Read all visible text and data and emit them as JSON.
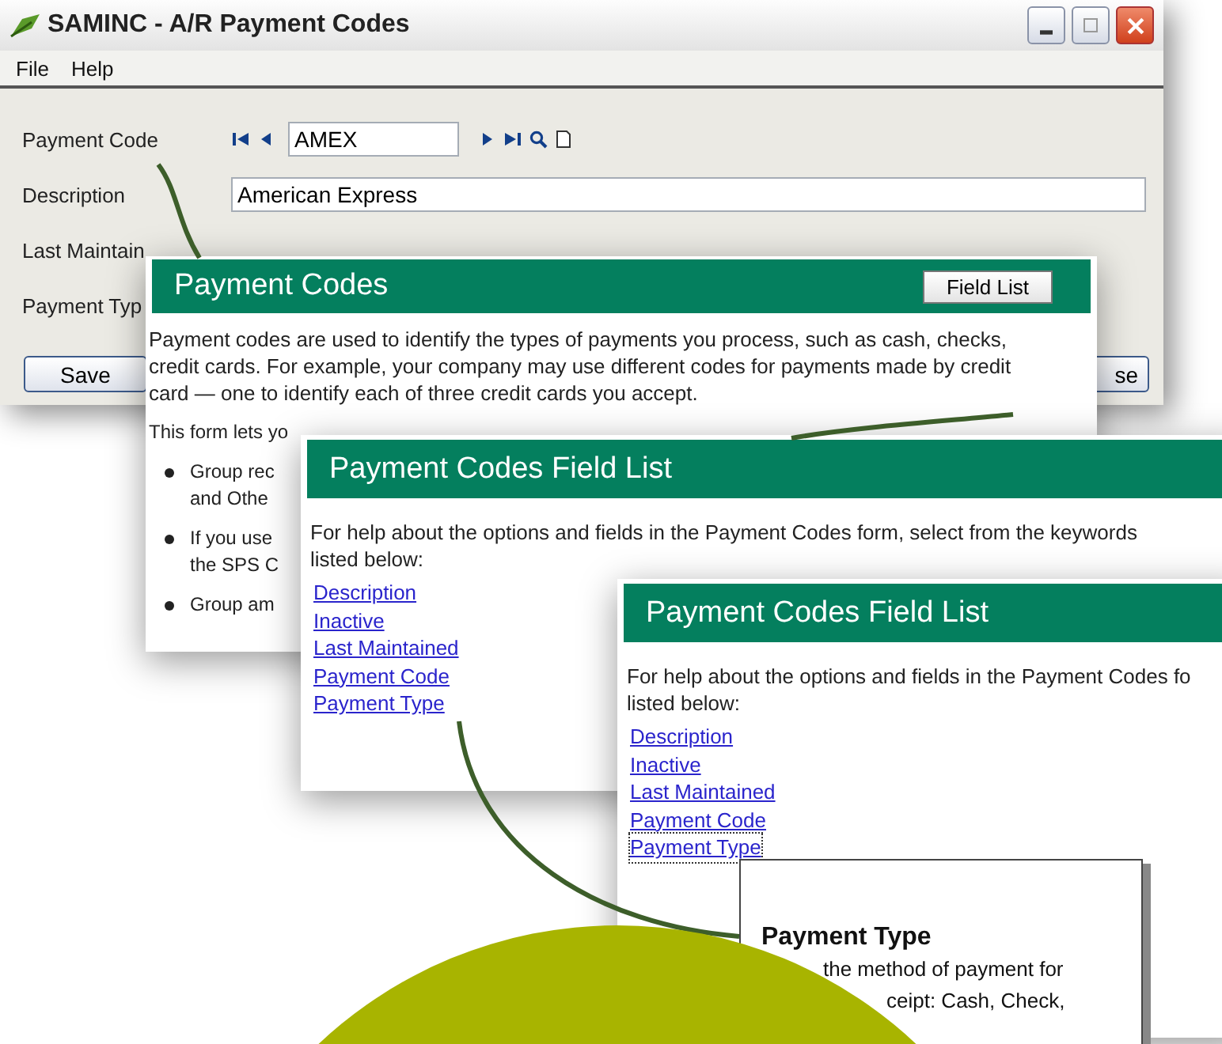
{
  "main_window": {
    "title": "SAMINC - A/R Payment Codes",
    "menu": [
      "File",
      "Help"
    ],
    "payment_code": {
      "label": "Payment Code",
      "value": "AMEX"
    },
    "description": {
      "label": "Description",
      "value": "American Express"
    },
    "labels": [
      "Last Maintain",
      "Payment Typ"
    ],
    "buttons": [
      "Save",
      "se"
    ]
  },
  "help_topic": {
    "title": "Payment Codes",
    "button": "Field List",
    "paragraph": [
      "Payment codes are used to identify the types of payments you process, such as cash, checks,",
      "credit cards. For example, your company may use different codes for payments made by credit",
      "card — one to identify each of three credit cards you accept."
    ],
    "intro": "This form lets yo",
    "bullets": [
      [
        "Group rec",
        "and Othe"
      ],
      [
        "If you use",
        "the SPS C"
      ],
      [
        "Group am"
      ]
    ]
  },
  "field_lists": [
    {
      "title": "Payment Codes Field List",
      "intro": [
        "For help about the options and fields in the Payment Codes form, select from the keywords",
        "listed below:"
      ],
      "links": [
        {
          "label": "Description",
          "focused": false
        },
        {
          "label": "Inactive",
          "focused": false
        },
        {
          "label": "Last Maintained",
          "focused": false
        },
        {
          "label": "Payment Code",
          "focused": false
        },
        {
          "label": "Payment Type",
          "focused": false
        }
      ]
    },
    {
      "title": "Payment Codes Field List",
      "intro": [
        "For help about the options and fields in the Payment Codes fo",
        "listed below:"
      ],
      "links": [
        {
          "label": "Description",
          "focused": false
        },
        {
          "label": "Inactive",
          "focused": false
        },
        {
          "label": "Last Maintained",
          "focused": false
        },
        {
          "label": "Payment Code",
          "focused": false
        },
        {
          "label": "Payment Type",
          "focused": true
        }
      ]
    }
  ],
  "popup": {
    "title": "Payment Type",
    "lines": [
      "the method of payment for",
      "ceipt: Cash, Check,"
    ]
  }
}
